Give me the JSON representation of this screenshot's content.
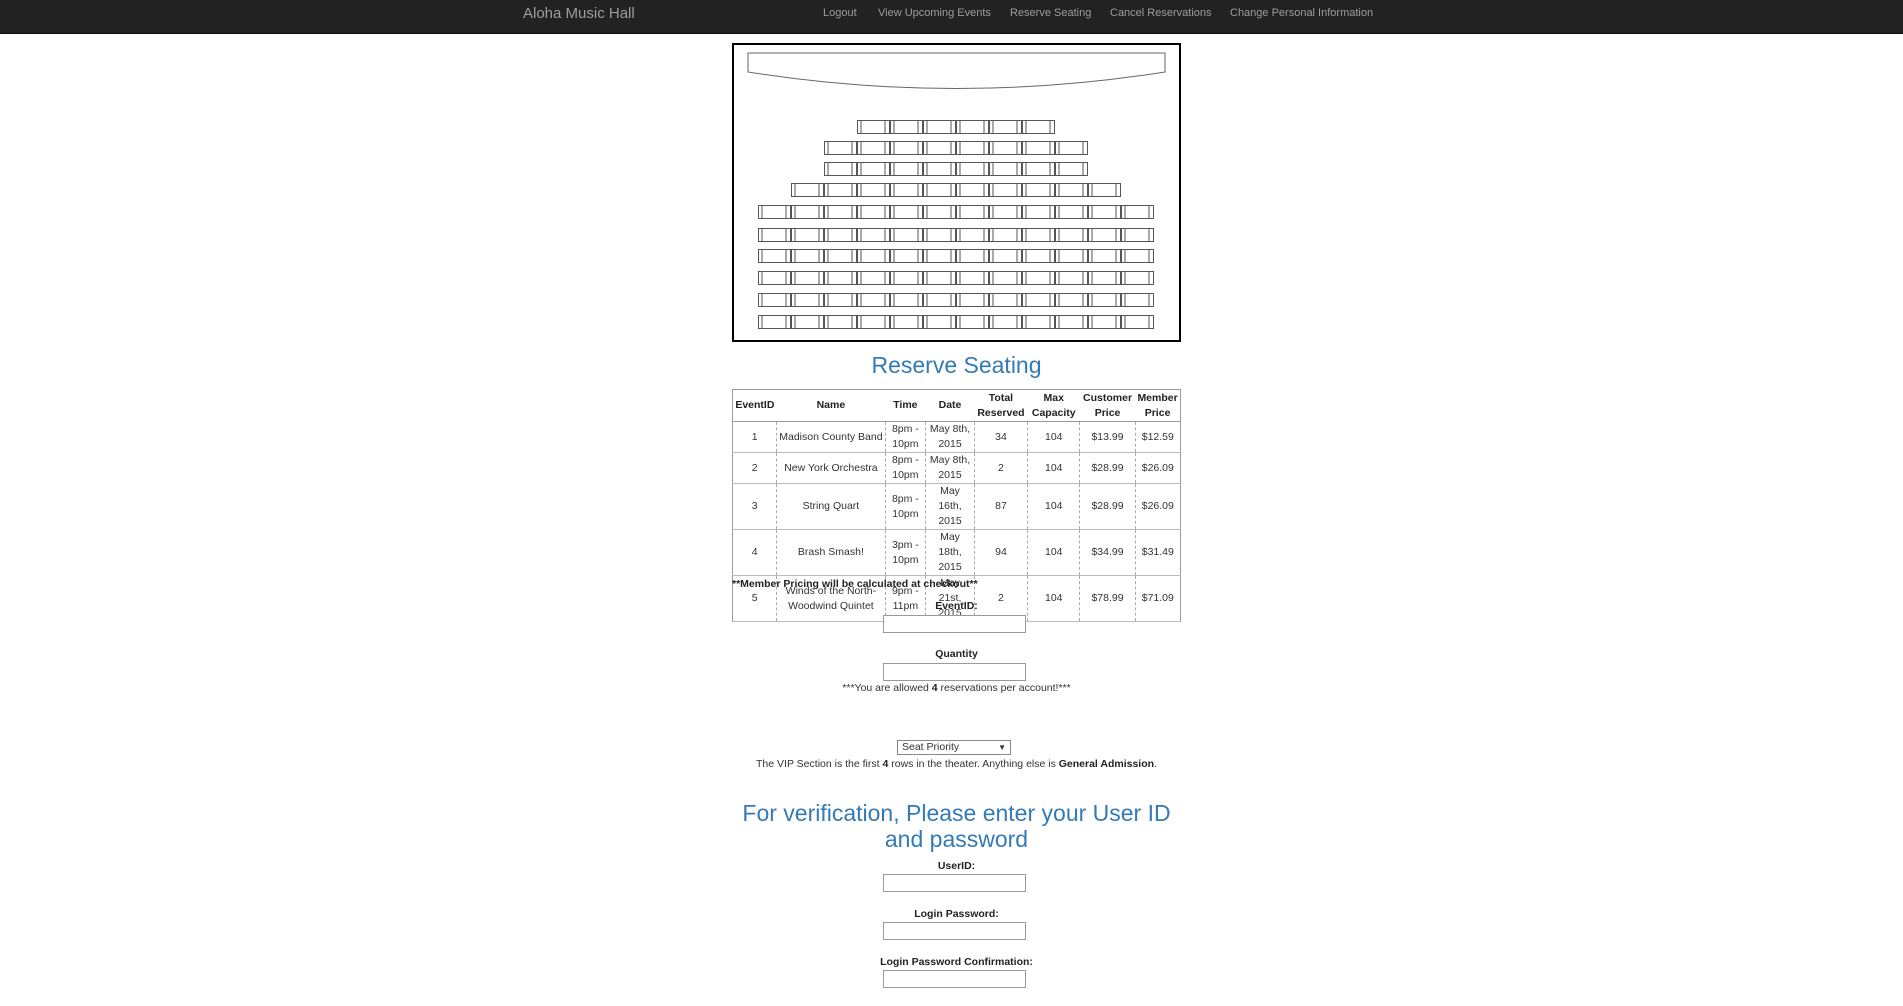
{
  "brand": "Aloha Music Hall",
  "nav": {
    "logout": "Logout",
    "upcoming": "View Upcoming Events",
    "reserve": "Reserve Seating",
    "cancel": "Cancel Reservations",
    "change": "Change Personal Information"
  },
  "theater": {
    "rows_seat_counts": [
      6,
      8,
      8,
      10,
      12,
      12,
      12,
      12,
      12,
      12
    ]
  },
  "title": "Reserve Seating",
  "table": {
    "headers": [
      [
        "EventID",
        ""
      ],
      [
        "Name",
        ""
      ],
      [
        "Time",
        ""
      ],
      [
        "Date",
        ""
      ],
      [
        "Total",
        "Reserved"
      ],
      [
        "Max",
        "Capacity"
      ],
      [
        "Customer",
        "Price"
      ],
      [
        "Member",
        "Price"
      ]
    ],
    "rows": [
      {
        "id": "1",
        "name": "Madison County Band",
        "time": "8pm - 10pm",
        "date": "May 8th, 2015",
        "reserved": "34",
        "capacity": "104",
        "customer": "$13.99",
        "member": "$12.59"
      },
      {
        "id": "2",
        "name": "New York Orchestra",
        "time": "8pm - 10pm",
        "date": "May 8th, 2015",
        "reserved": "2",
        "capacity": "104",
        "customer": "$28.99",
        "member": "$26.09"
      },
      {
        "id": "3",
        "name": "String Quart",
        "time": "8pm - 10pm",
        "date": "May 16th, 2015",
        "reserved": "87",
        "capacity": "104",
        "customer": "$28.99",
        "member": "$26.09"
      },
      {
        "id": "4",
        "name": "Brash Smash!",
        "time": "3pm - 10pm",
        "date": "May 18th, 2015",
        "reserved": "94",
        "capacity": "104",
        "customer": "$34.99",
        "member": "$31.49"
      },
      {
        "id": "5",
        "name": "Winds of the North- Woodwind Quintet",
        "time": "9pm - 11pm",
        "date": "May 21st, 2015",
        "reserved": "2",
        "capacity": "104",
        "customer": "$78.99",
        "member": "$71.09"
      }
    ]
  },
  "member_note": "**Member Pricing will be calculated at checkout**",
  "form": {
    "eventid_label": "EventID:",
    "quantity_label": "Quantity",
    "allow_pre": "***You are allowed ",
    "allow_num": "4",
    "allow_post": " reservations per account!***",
    "seat_priority": "Seat Priority",
    "vip_pre": "The VIP Section is the first ",
    "vip_num": "4",
    "vip_mid": " rows in the theater. Anything else is ",
    "vip_bold": "General Admission",
    "vip_end": "."
  },
  "verify": {
    "title": "For verification, Please enter your User ID and password",
    "userid_label": "UserID:",
    "password_label": "Login Password:",
    "confirm_label": "Login Password Confirmation:"
  }
}
